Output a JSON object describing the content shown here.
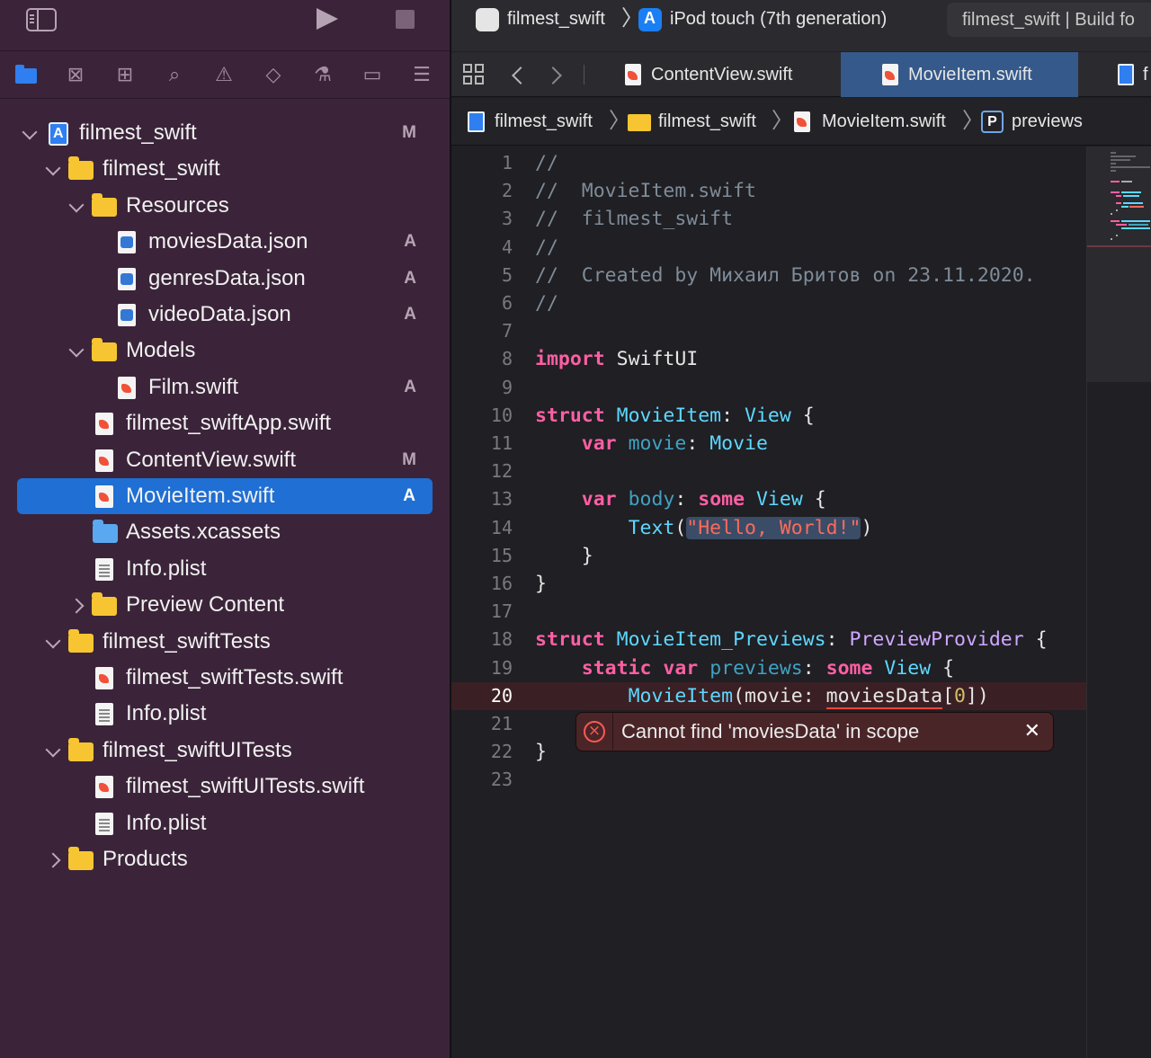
{
  "toolbar": {
    "scheme": "filmest_swift",
    "destination": "iPod touch (7th generation)",
    "build_status": "filmest_swift | Build fo"
  },
  "navigator_tabs": [
    "project-navigator",
    "source-control",
    "symbols",
    "find",
    "issues",
    "tests",
    "debug",
    "breakpoints",
    "reports"
  ],
  "tree": [
    {
      "label": "filmest_swift",
      "status": "M",
      "type": "project"
    },
    {
      "label": "filmest_swift",
      "status": "",
      "type": "folder"
    },
    {
      "label": "Resources",
      "status": "",
      "type": "folder"
    },
    {
      "label": "moviesData.json",
      "status": "A",
      "type": "json"
    },
    {
      "label": "genresData.json",
      "status": "A",
      "type": "json"
    },
    {
      "label": "videoData.json",
      "status": "A",
      "type": "json"
    },
    {
      "label": "Models",
      "status": "",
      "type": "folder"
    },
    {
      "label": "Film.swift",
      "status": "A",
      "type": "swift"
    },
    {
      "label": "filmest_swiftApp.swift",
      "status": "",
      "type": "swift"
    },
    {
      "label": "ContentView.swift",
      "status": "M",
      "type": "swift"
    },
    {
      "label": "MovieItem.swift",
      "status": "A",
      "type": "swift"
    },
    {
      "label": "Assets.xcassets",
      "status": "",
      "type": "assets"
    },
    {
      "label": "Info.plist",
      "status": "",
      "type": "plist"
    },
    {
      "label": "Preview Content",
      "status": "",
      "type": "folder"
    },
    {
      "label": "filmest_swiftTests",
      "status": "",
      "type": "folder"
    },
    {
      "label": "filmest_swiftTests.swift",
      "status": "",
      "type": "swift"
    },
    {
      "label": "Info.plist",
      "status": "",
      "type": "plist"
    },
    {
      "label": "filmest_swiftUITests",
      "status": "",
      "type": "folder"
    },
    {
      "label": "filmest_swiftUITests.swift",
      "status": "",
      "type": "swift"
    },
    {
      "label": "Info.plist",
      "status": "",
      "type": "plist"
    },
    {
      "label": "Products",
      "status": "",
      "type": "folder"
    }
  ],
  "tabs": {
    "tab1": "ContentView.swift",
    "tab2": "MovieItem.swift",
    "tab3": "f"
  },
  "jumpbar": {
    "project": "filmest_swift",
    "group": "filmest_swift",
    "file": "MovieItem.swift",
    "symbol_badge": "P",
    "symbol": "previews"
  },
  "code": {
    "l2": "//  MovieItem.swift",
    "l3": "//  filmest_swift",
    "l5": "//  Created by Михаил Бритов on 23.11.2020.",
    "import_kw": "import",
    "import_mod": "SwiftUI",
    "struct_kw": "struct",
    "struct1": "MovieItem",
    "view_type": "View",
    "var_kw": "var",
    "movie_prop": "movie",
    "movie_type": "Movie",
    "body_prop": "body",
    "some_kw": "some",
    "text_fn": "Text",
    "hello_str": "\"Hello, World!\"",
    "struct2": "MovieItem_Previews",
    "preview_provider": "PreviewProvider",
    "static_kw": "static",
    "previews_prop": "previews",
    "call_fn": "MovieItem",
    "call_label": "movie: ",
    "err_ident": "moviesData",
    "index": "0"
  },
  "error": {
    "message": "Cannot find 'moviesData' in scope"
  },
  "colors": {
    "navigator_bg": "#3b2439",
    "selection": "#1f6fd4",
    "editor_bg": "#1f1f24",
    "keyword": "#fc5fa3",
    "type": "#5dd8ff",
    "string": "#fc6a5d",
    "error": "#ff453a"
  }
}
